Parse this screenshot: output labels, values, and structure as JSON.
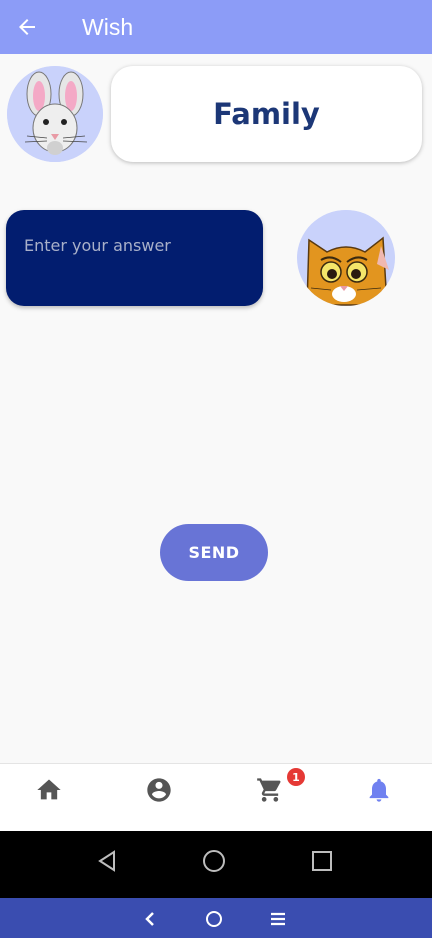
{
  "header": {
    "title": "Wish",
    "back_icon": "arrow-left-icon",
    "background": "#8c9cf7"
  },
  "category": {
    "title": "Family",
    "avatar_icon": "rabbit-avatar"
  },
  "answer": {
    "placeholder": "Enter your answer",
    "value": "",
    "avatar_icon": "cat-avatar"
  },
  "send_button": {
    "label": "SEND",
    "color": "#6874d6"
  },
  "bottom_nav": {
    "items": [
      {
        "icon": "home-icon"
      },
      {
        "icon": "account-circle-icon"
      },
      {
        "icon": "cart-icon",
        "badge": "1"
      },
      {
        "icon": "bell-icon",
        "active": true
      }
    ],
    "active_color": "#7081f0",
    "inactive_color": "#555555"
  },
  "system_nav": {
    "buttons": [
      "back-triangle-icon",
      "home-circle-icon",
      "recents-square-icon"
    ]
  },
  "system_nav_secondary": {
    "buttons": [
      "chevron-left-icon",
      "circle-icon",
      "menu-lines-icon"
    ]
  }
}
